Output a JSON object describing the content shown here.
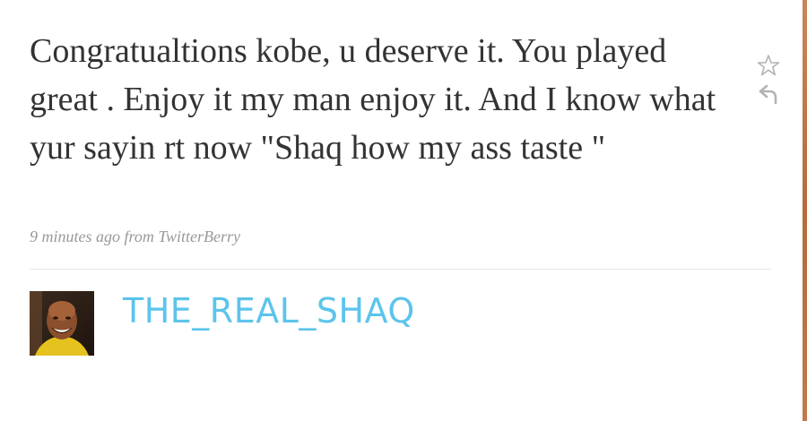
{
  "tweet": {
    "text": "Congratualtions kobe, u deserve it. You played great . Enjoy it my man enjoy it. And I know what yur sayin rt now \"Shaq how my ass taste \"",
    "timestamp": "9 minutes ago",
    "from_label": "from",
    "source": "TwitterBerry"
  },
  "actions": {
    "favorite_icon": "star-icon",
    "reply_icon": "reply-arrow-icon"
  },
  "author": {
    "screen_name": "THE_REAL_SHAQ",
    "avatar_icon": "avatar-photo"
  },
  "colors": {
    "tweet_text": "#333333",
    "meta_text": "#999999",
    "screen_name": "#5cc4ec",
    "divider": "#e6e6e6"
  }
}
